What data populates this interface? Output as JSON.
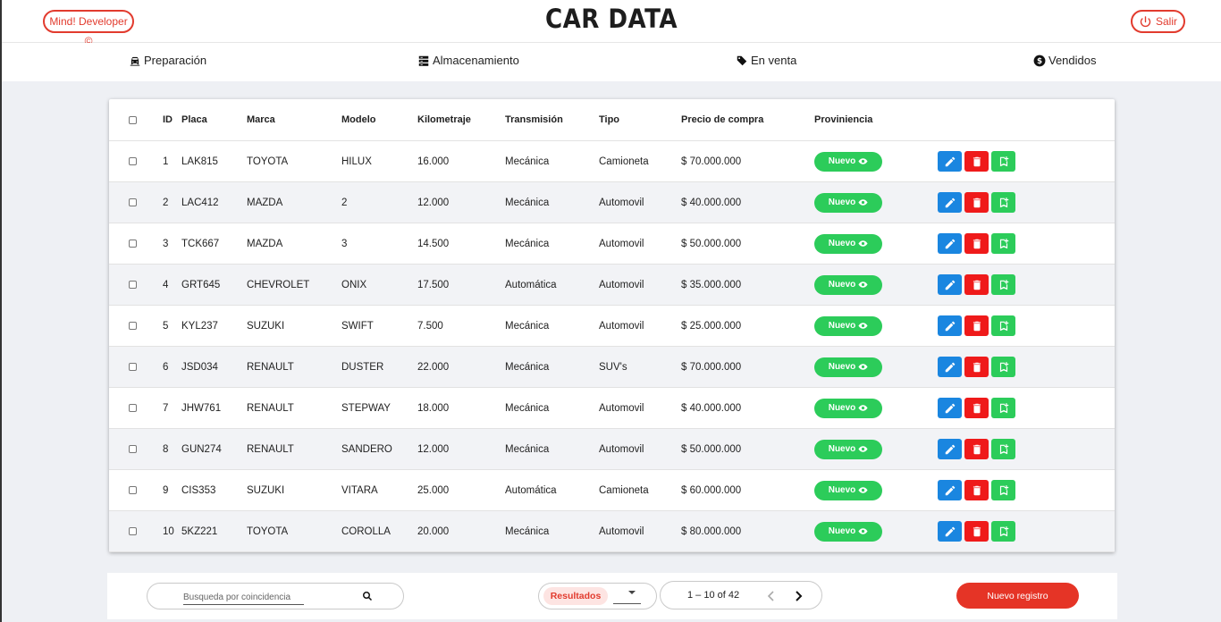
{
  "header": {
    "brand": "Mind! Developer ©",
    "title": "CAR DATA",
    "logout_label": "Salir"
  },
  "nav": {
    "items": [
      {
        "label": "Preparación",
        "icon": "car-icon"
      },
      {
        "label": "Almacenamiento",
        "icon": "storage-icon"
      },
      {
        "label": "En venta",
        "icon": "tag-icon"
      },
      {
        "label": "Vendidos",
        "icon": "dollar-icon"
      }
    ]
  },
  "table": {
    "columns": [
      "ID",
      "Placa",
      "Marca",
      "Modelo",
      "Kilometraje",
      "Transmisión",
      "Tipo",
      "Precio de compra",
      "Proviniencia"
    ],
    "rows": [
      {
        "id": "1",
        "placa": "LAK815",
        "marca": "TOYOTA",
        "modelo": "HILUX",
        "km": "16.000",
        "trans": "Mecánica",
        "tipo": "Camioneta",
        "precio": "$ 70.000.000",
        "prov": "Nuevo"
      },
      {
        "id": "2",
        "placa": "LAC412",
        "marca": "MAZDA",
        "modelo": "2",
        "km": "12.000",
        "trans": "Mecánica",
        "tipo": "Automovil",
        "precio": "$ 40.000.000",
        "prov": "Nuevo"
      },
      {
        "id": "3",
        "placa": "TCK667",
        "marca": "MAZDA",
        "modelo": "3",
        "km": "14.500",
        "trans": "Mecánica",
        "tipo": "Automovil",
        "precio": "$ 50.000.000",
        "prov": "Nuevo"
      },
      {
        "id": "4",
        "placa": "GRT645",
        "marca": "CHEVROLET",
        "modelo": "ONIX",
        "km": "17.500",
        "trans": "Automática",
        "tipo": "Automovil",
        "precio": "$ 35.000.000",
        "prov": "Nuevo"
      },
      {
        "id": "5",
        "placa": "KYL237",
        "marca": "SUZUKI",
        "modelo": "SWIFT",
        "km": "7.500",
        "trans": "Mecánica",
        "tipo": "Automovil",
        "precio": "$ 25.000.000",
        "prov": "Nuevo"
      },
      {
        "id": "6",
        "placa": "JSD034",
        "marca": "RENAULT",
        "modelo": "DUSTER",
        "km": "22.000",
        "trans": "Mecánica",
        "tipo": "SUV's",
        "precio": "$ 70.000.000",
        "prov": "Nuevo"
      },
      {
        "id": "7",
        "placa": "JHW761",
        "marca": "RENAULT",
        "modelo": "STEPWAY",
        "km": "18.000",
        "trans": "Mecánica",
        "tipo": "Automovil",
        "precio": "$ 40.000.000",
        "prov": "Nuevo"
      },
      {
        "id": "8",
        "placa": "GUN274",
        "marca": "RENAULT",
        "modelo": "SANDERO",
        "km": "12.000",
        "trans": "Mecánica",
        "tipo": "Automovil",
        "precio": "$ 50.000.000",
        "prov": "Nuevo"
      },
      {
        "id": "9",
        "placa": "CIS353",
        "marca": "SUZUKI",
        "modelo": "VITARA",
        "km": "25.000",
        "trans": "Automática",
        "tipo": "Camioneta",
        "precio": "$ 60.000.000",
        "prov": "Nuevo"
      },
      {
        "id": "10",
        "placa": "5KZ221",
        "marca": "TOYOTA",
        "modelo": "COROLLA",
        "km": "20.000",
        "trans": "Mecánica",
        "tipo": "Automovil",
        "precio": "$ 80.000.000",
        "prov": "Nuevo"
      }
    ]
  },
  "footer": {
    "search_placeholder": "Busqueda por coincidencia",
    "results_label": "Resultados",
    "pagination_text": "1 – 10 of 42",
    "new_button": "Nuevo registro"
  },
  "colors": {
    "accent_red": "#e23b2e",
    "edit_blue": "#1a86e0",
    "delete_red": "#ef1a1a",
    "green": "#2ccc5a"
  }
}
